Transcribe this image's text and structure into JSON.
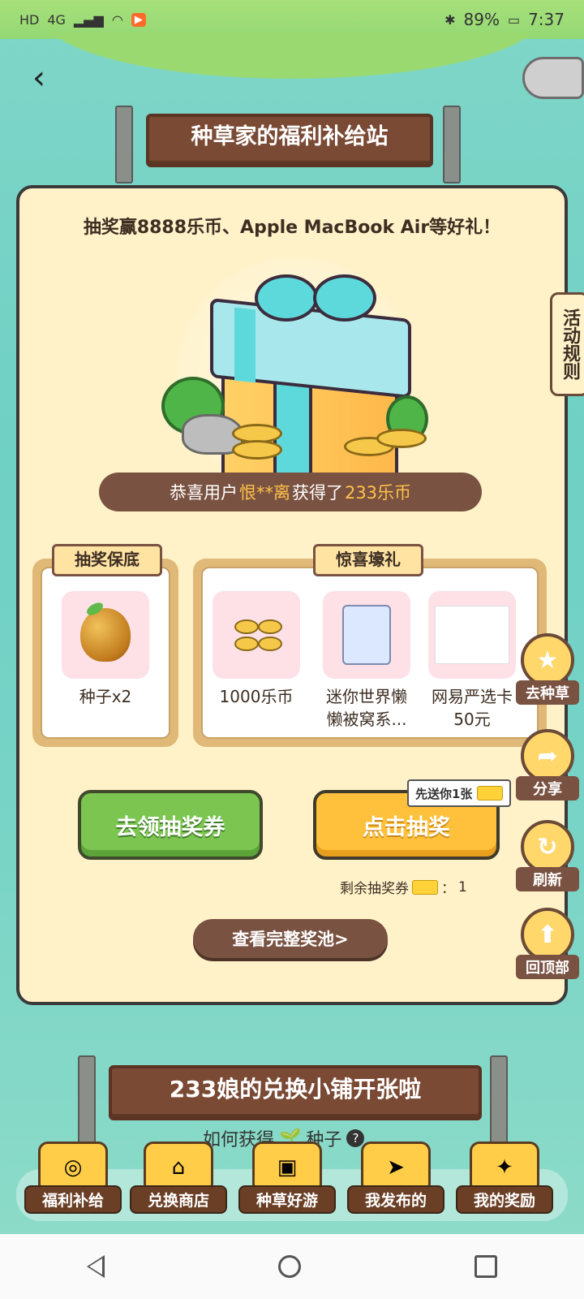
{
  "status_bar": {
    "left_icons": [
      "HD",
      "4G",
      "signal",
      "wifi",
      "play-badge"
    ],
    "battery_percent": "89%",
    "time": "7:37"
  },
  "top_sign": {
    "title": "种草家的福利补给站"
  },
  "main_card": {
    "headline": "抽奖赢8888乐币、Apple MacBook Air等好礼！",
    "notice": {
      "prefix": "恭喜用户",
      "user": "恨**离",
      "middle": "获得了",
      "prize": "233乐币"
    }
  },
  "rules_tab": {
    "label": "活动规则"
  },
  "guarantee_panel": {
    "tag": "抽奖保底",
    "prizes": [
      {
        "label": "种子x2",
        "icon": "seed-icon"
      }
    ]
  },
  "surprise_panel": {
    "tag": "惊喜壕礼",
    "prizes": [
      {
        "label": "1000乐币",
        "icon": "coins-icon"
      },
      {
        "label": "迷你世界懒懒被窝系...",
        "icon": "toy-box-icon"
      },
      {
        "label": "网易严选卡50元",
        "icon": "card-icon"
      }
    ]
  },
  "actions": {
    "get_tickets": "去领抽奖券",
    "draw": "点击抽奖",
    "gift_tip": "先送你1张",
    "remaining_label": "剩余抽奖券",
    "remaining_count": "1",
    "view_pool": "查看完整奖池>"
  },
  "float_buttons": [
    {
      "label": "去种草",
      "icon": "star-icon"
    },
    {
      "label": "分享",
      "icon": "share-arrow-icon"
    },
    {
      "label": "刷新",
      "icon": "refresh-icon"
    },
    {
      "label": "回顶部",
      "icon": "arrow-up-icon"
    }
  ],
  "second_sign": {
    "title": "233娘的兑换小铺开张啦"
  },
  "howto": {
    "label": "如何获得",
    "seed_word": "种子"
  },
  "tabs": [
    {
      "label": "福利补给",
      "icon": "coins-basket-icon"
    },
    {
      "label": "兑换商店",
      "icon": "shop-icon"
    },
    {
      "label": "种草好游",
      "icon": "game-console-icon"
    },
    {
      "label": "我发布的",
      "icon": "paper-plane-icon"
    },
    {
      "label": "我的奖励",
      "icon": "gift-icon"
    }
  ],
  "colors": {
    "card_bg": "#fff2c9",
    "brown": "#7a5242",
    "highlight": "#ffc24a",
    "green_btn": "#7cc550",
    "yellow_btn": "#ffc13b"
  }
}
